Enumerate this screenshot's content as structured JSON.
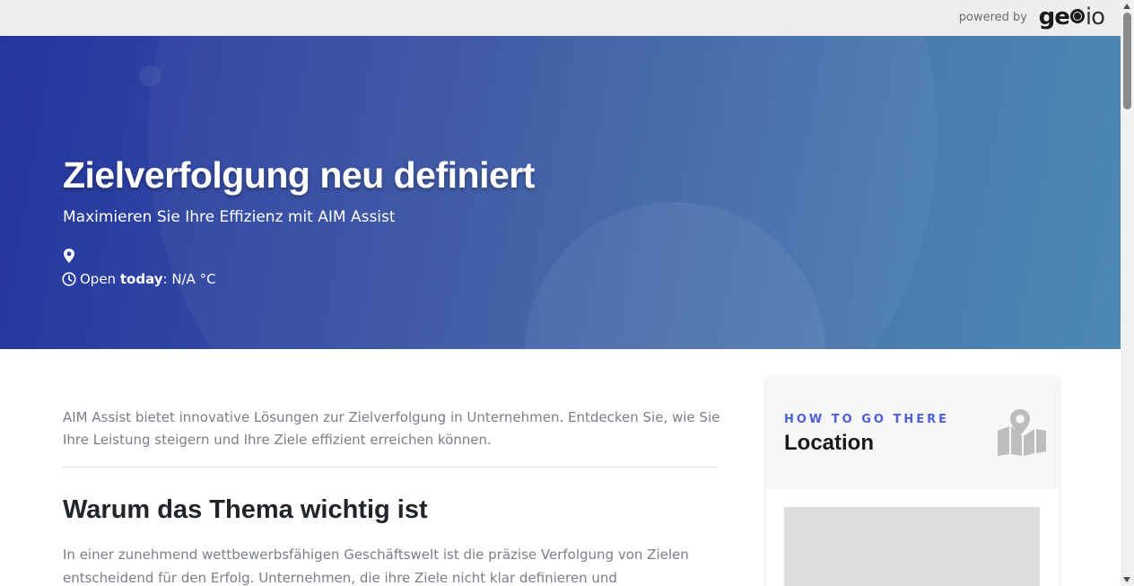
{
  "topbar": {
    "powered_by": "powered by",
    "logo_left": "ge",
    "logo_right": "io"
  },
  "hero": {
    "title": "Zielverfolgung neu definiert",
    "subtitle": "Maximieren Sie Ihre Effizienz mit AIM Assist",
    "hours_prefix": "Open",
    "hours_day": "today",
    "hours_suffix": ": N/A °C"
  },
  "main": {
    "intro": "AIM Assist bietet innovative Lösungen zur Zielverfolgung in Unternehmen. Entdecken Sie, wie Sie Ihre Leistung steigern und Ihre Ziele effizient erreichen können.",
    "section_title": "Warum das Thema wichtig ist",
    "section_body": "In einer zunehmend wettbewerbsfähigen Geschäftswelt ist die präzise Verfolgung von Zielen entscheidend für den Erfolg. Unternehmen, die ihre Ziele nicht klar definieren und"
  },
  "sidebar": {
    "kicker": "HOW TO GO THERE",
    "title": "Location"
  },
  "icons": {
    "pin": "map-pin-icon",
    "clock": "clock-icon",
    "map": "map-location-icon"
  },
  "colors": {
    "hero_gradient_start": "#2435a0",
    "hero_gradient_end": "#4d89b2",
    "kicker": "#4d5fdc",
    "body_text": "#7a7f87"
  }
}
